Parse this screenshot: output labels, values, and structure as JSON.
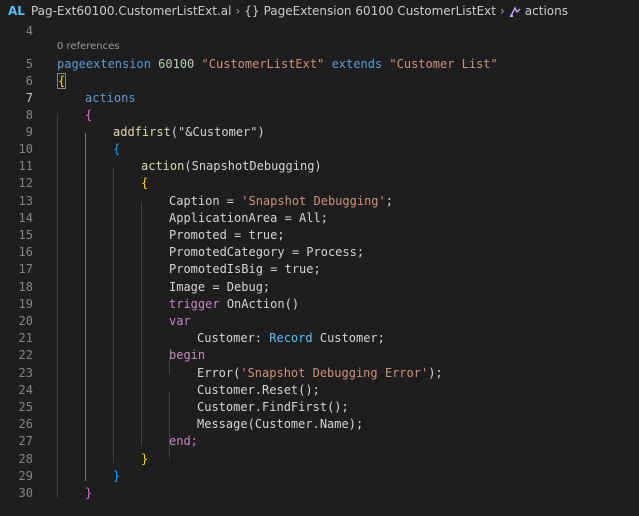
{
  "breadcrumb": {
    "lang": "AL",
    "file": "Pag-Ext60100.CustomerListExt.al",
    "symbol": "PageExtension 60100 CustomerListExt",
    "member": "actions"
  },
  "editor": {
    "codelens": "0 references",
    "line_numbers": [
      "4",
      "5",
      "6",
      "7",
      "8",
      "9",
      "10",
      "11",
      "12",
      "13",
      "14",
      "15",
      "16",
      "17",
      "18",
      "19",
      "20",
      "21",
      "22",
      "23",
      "24",
      "25",
      "26",
      "27",
      "28",
      "29",
      "30"
    ],
    "code": {
      "l5": [
        "pageextension",
        " ",
        "60100",
        " ",
        "\"CustomerListExt\"",
        " ",
        "extends",
        " ",
        "\"Customer List\""
      ],
      "l6": "{",
      "l7": "actions",
      "l8": "{",
      "l9": [
        "addfirst",
        "(",
        "\"&Customer\"",
        ")"
      ],
      "l10": "{",
      "l11": [
        "action",
        "(",
        "SnapshotDebugging",
        ")"
      ],
      "l12": "{",
      "l13": [
        "Caption = ",
        "'Snapshot Debugging'",
        ";"
      ],
      "l14": "ApplicationArea = All;",
      "l15": "Promoted = true;",
      "l16": "PromotedCategory = Process;",
      "l17": "PromotedIsBig = true;",
      "l18": "Image = Debug;",
      "l19": [
        "trigger",
        " ",
        "OnAction",
        "()"
      ],
      "l20": "var",
      "l21": [
        "Customer: ",
        "Record",
        " ",
        "Customer",
        ";"
      ],
      "l22": "begin",
      "l23": [
        "Error",
        "(",
        "'Snapshot Debugging Error'",
        ");"
      ],
      "l24": [
        "Customer.",
        "Reset",
        "();"
      ],
      "l25": [
        "Customer.",
        "FindFirst",
        "();"
      ],
      "l26": [
        "Message",
        "(",
        "Customer.Name",
        ");"
      ],
      "l27": "end;",
      "l28": "}",
      "l29": "}",
      "l30": "}"
    }
  }
}
